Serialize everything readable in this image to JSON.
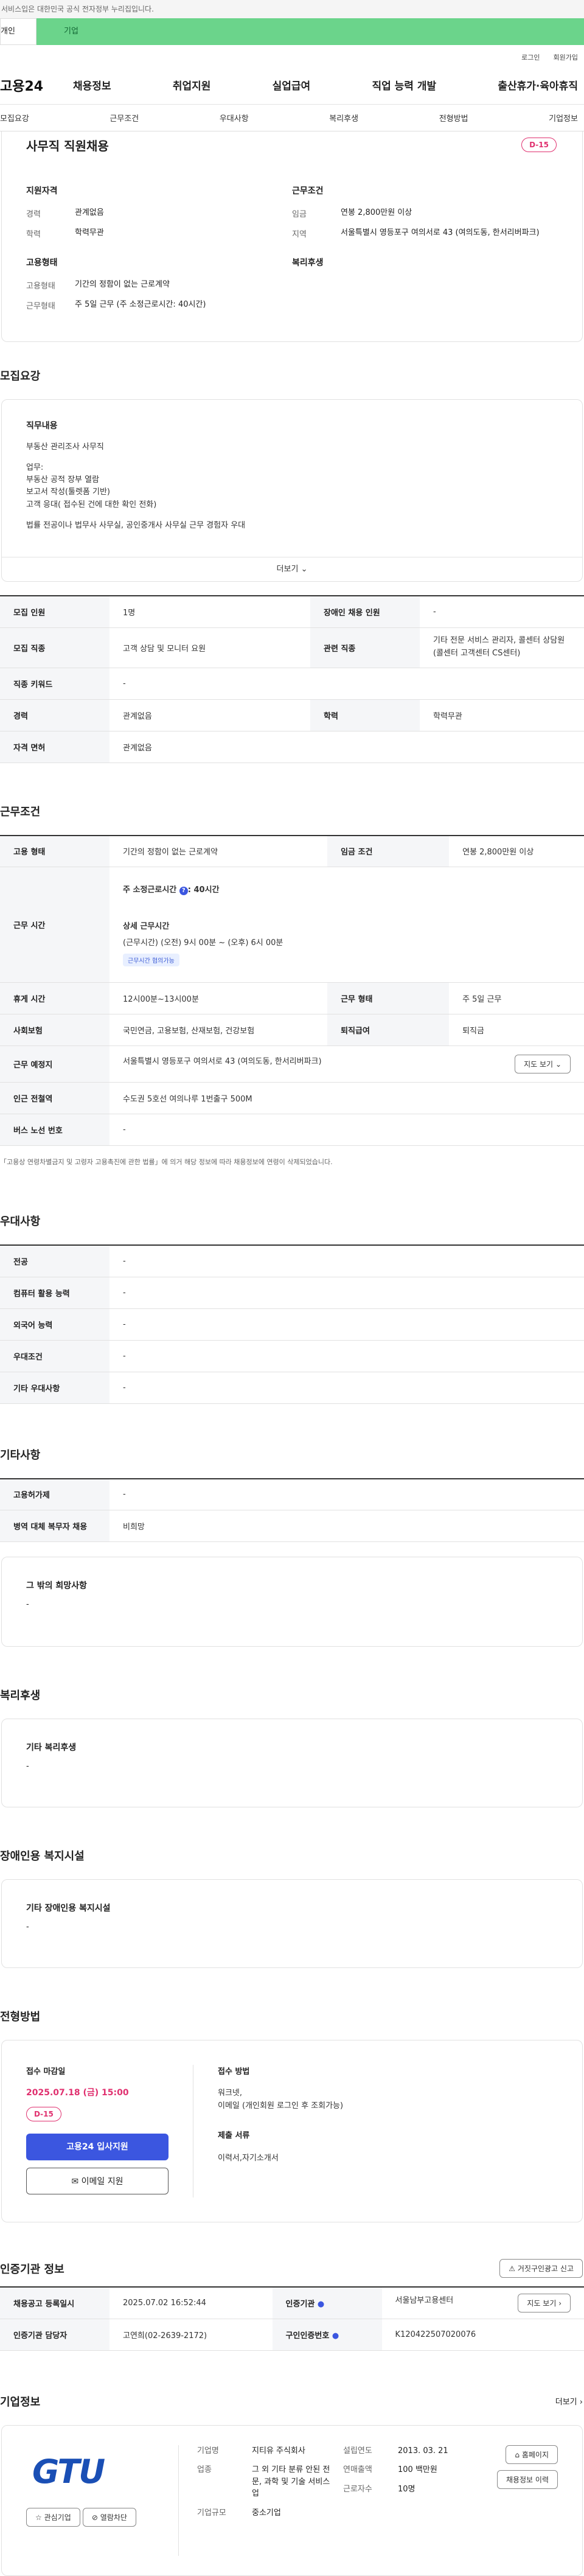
{
  "top_notice": "서비스입은 대한민국 공식 전자정부 누리집입니다.",
  "user_tabs": [
    "개인",
    "기업"
  ],
  "util_links": [
    "로그인",
    "회원가입"
  ],
  "logo": "고용24",
  "gnb": [
    "채용정보",
    "취업지원",
    "실업급여",
    "직업 능력 개발",
    "출산휴가·육아휴직"
  ],
  "subtabs": [
    "모집요강",
    "근무조건",
    "우대사항",
    "복리후생",
    "전형방법",
    "기업정보"
  ],
  "header": {
    "title": "사무직 직원채용",
    "dday": "D-15",
    "qual_title": "지원자격",
    "qual": [
      {
        "k": "경력",
        "v": "관계없음"
      },
      {
        "k": "학력",
        "v": "학력무관"
      }
    ],
    "cond_title": "근무조건",
    "cond": [
      {
        "k": "임금",
        "v": "연봉 2,800만원 이상"
      },
      {
        "k": "지역",
        "v": "서울특별시 영등포구 여의서로 43 (여의도동, 한서리버파크)"
      }
    ],
    "emp_title": "고용형태",
    "emp": [
      {
        "k": "고용형태",
        "v": "기간의 정함이 없는 근로계약"
      },
      {
        "k": "근무형태",
        "v": "주 5일 근무 (주 소정근로시간: 40시간)"
      }
    ],
    "welfare_title": "복리후생"
  },
  "recruit": {
    "title": "모집요강",
    "desc_title": "직무내용",
    "desc": [
      "부동산 관리조사 사무직",
      "",
      "업무:",
      "부동산 공적 장부 열람",
      "보고서 작성(툴렛폼 기반)",
      "고객 응대( 접수된 건에 대한 확인 전화)",
      "",
      "법률 전공이나 법무사 사무실, 공인중개사 사무실 근무 경험자 우대"
    ],
    "more": "더보기",
    "rows": [
      [
        {
          "k": "모집 인원",
          "v": "1명"
        },
        {
          "k": "장애인 채용 인원",
          "v": "-"
        }
      ],
      [
        {
          "k": "모집 직종",
          "v": "고객 상담 및 모니터 요원"
        },
        {
          "k": "관련 직종",
          "v": "기타 전문 서비스 관리자, 콜센터 상담원(콜센터 고객센터 CS센터)"
        }
      ],
      [
        {
          "k": "직종 키워드",
          "v": "-"
        }
      ],
      [
        {
          "k": "경력",
          "v": "관계없음"
        },
        {
          "k": "학력",
          "v": "학력무관"
        }
      ],
      [
        {
          "k": "자격 면허",
          "v": "관계없음"
        }
      ]
    ]
  },
  "work": {
    "title": "근무조건",
    "emp_type": {
      "k": "고용 형태",
      "v": "기간의 정함이 없는 근로계약"
    },
    "wage": {
      "k": "임금 조건",
      "v": "연봉 2,800만원 이상"
    },
    "hours_k": "근무 시간",
    "hours_main": "주 소정근로시간",
    "hours_main_v": ": 40시간",
    "hours_detail_t": "상세 근무시간",
    "hours_detail": "(근무시간) (오전) 9시 00분 ~ (오후) 6시 00분",
    "hours_chip": "근무시간 협의가능",
    "rest": {
      "k": "휴게 시간",
      "v": "12시00분~13시00분"
    },
    "form": {
      "k": "근무 형태",
      "v": "주 5일 근무"
    },
    "insure": {
      "k": "사회보험",
      "v": "국민연금, 고용보험, 산재보험, 건강보험"
    },
    "retire": {
      "k": "퇴직급여",
      "v": "퇴직금"
    },
    "place": {
      "k": "근무 예정지",
      "v": "서울특별시 영등포구 여의서로 43 (여의도동, 한서리버파크)",
      "btn": "지도 보기"
    },
    "subway": {
      "k": "인근 전철역",
      "v": "수도권 5호선 여의나루 1번출구 500M"
    },
    "bus": {
      "k": "버스 노선 번호",
      "v": "-"
    },
    "note": "「고용상 연령차별금지 및 고령자 고용촉진에 관한 법률」에 의거 해당 정보에 따라 채용정보에 연령이 삭제되었습니다."
  },
  "pref": {
    "title": "우대사항",
    "rows": [
      {
        "k": "전공",
        "v": "-"
      },
      {
        "k": "컴퓨터 활용 능력",
        "v": "-"
      },
      {
        "k": "외국어 능력",
        "v": "-"
      },
      {
        "k": "우대조건",
        "v": "-"
      },
      {
        "k": "기타 우대사항",
        "v": "-"
      }
    ]
  },
  "etc": {
    "title": "기타사항",
    "rows": [
      {
        "k": "고용허가제",
        "v": "-"
      },
      {
        "k": "병역 대체 복무자 채용",
        "v": "비희망"
      }
    ],
    "other_title": "그 밖의 희망사항",
    "other_v": "-"
  },
  "welfare": {
    "title": "복리후생",
    "sub": "기타 복리후생",
    "v": "-"
  },
  "disabled": {
    "title": "장애인용 복지시설",
    "sub": "기타 장애인용 복지시설",
    "v": "-"
  },
  "apply": {
    "title": "전형방법",
    "deadline_t": "접수 마감일",
    "deadline": "2025.07.18 (금) 15:00",
    "dday": "D-15",
    "btn_primary": "고용24 입사지원",
    "btn_email": "이메일 지원",
    "method_t": "접수 방법",
    "method": [
      "워크넷,",
      "이메일 (개인회원 로그인 후 조회가능)"
    ],
    "docs_t": "제출 서류",
    "docs": "이력서,자기소개서"
  },
  "agency": {
    "title": "인증기관 정보",
    "report": "거짓구인광고 신고",
    "rows": [
      [
        {
          "k": "채용공고 등록일시",
          "v": "2025.07.02 16:52:44"
        },
        {
          "k": "인증기관",
          "v": "서울남부고용센터",
          "btn": "지도 보기"
        }
      ],
      [
        {
          "k": "인증기관 담당자",
          "v": "고연희(02-2639-2172)"
        },
        {
          "k": "구인인증번호",
          "v": "K120422507020076"
        }
      ]
    ]
  },
  "company": {
    "title": "기업정보",
    "more": "더보기",
    "logo_text": "GTU",
    "interest": "관심기업",
    "block": "열람차단",
    "col1": [
      {
        "k": "기업명",
        "v": "지티유 주식회사"
      },
      {
        "k": "업종",
        "v": "그 외 기타 분류 안된 전문, 과학 및 기술 서비스업"
      },
      {
        "k": "기업규모",
        "v": "중소기업"
      }
    ],
    "col2": [
      {
        "k": "설립연도",
        "v": "2013. 03. 21"
      },
      {
        "k": "연매출액",
        "v": "100 백만원"
      },
      {
        "k": "근로자수",
        "v": "10명"
      }
    ],
    "homepage": "홈페이지",
    "jobs": "채용정보 이력"
  }
}
